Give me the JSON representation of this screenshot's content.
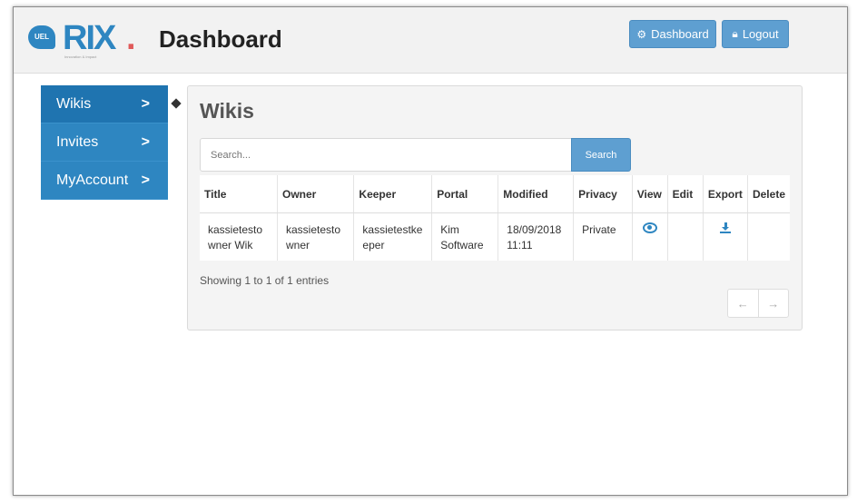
{
  "header": {
    "logo": {
      "badge": "UEL",
      "brand": "RIX",
      "dot": ".",
      "tagline": "Innovation & Impact"
    },
    "title": "Dashboard",
    "buttons": {
      "dashboard": {
        "label": "Dashboard",
        "icon": "gears-icon"
      },
      "logout": {
        "label": "Logout",
        "icon": "lock-icon"
      }
    }
  },
  "sidebar": {
    "items": [
      {
        "label": "Wikis",
        "active": true
      },
      {
        "label": "Invites",
        "active": false
      },
      {
        "label": "MyAccount",
        "active": false
      }
    ]
  },
  "main": {
    "title": "Wikis",
    "search": {
      "placeholder": "Search...",
      "value": "",
      "button_label": "Search"
    },
    "table": {
      "headers": [
        "Title",
        "Owner",
        "Keeper",
        "Portal",
        "Modified",
        "Privacy",
        "View",
        "Edit",
        "Export",
        "Delete"
      ],
      "rows": [
        {
          "title": "kassietesto wner Wik",
          "owner": "kassietesto wner",
          "keeper": "kassietestke eper",
          "portal": "Kim Software",
          "modified": "18/09/2018 11:11",
          "privacy": "Private",
          "view_icon": "eye-icon",
          "export_icon": "download-icon"
        }
      ]
    },
    "entries_text": "Showing 1 to 1 of 1 entries",
    "pager": {
      "prev": "←",
      "next": "→"
    }
  },
  "colors": {
    "brand": "#2e86c1",
    "button": "#5e9fd1",
    "accent_red": "#e05a5a"
  }
}
